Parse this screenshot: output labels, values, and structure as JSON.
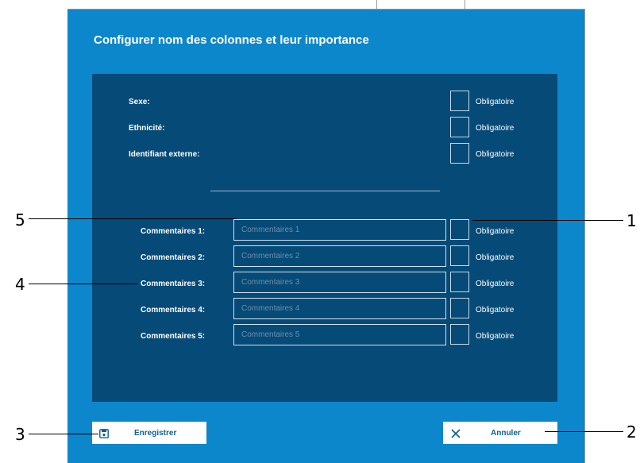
{
  "dialog": {
    "title": "Configurer nom des colonnes et leur importance"
  },
  "fixed_fields": [
    {
      "label": "Sexe:",
      "mandatory_label": "Obligatoire"
    },
    {
      "label": "Ethnicité:",
      "mandatory_label": "Obligatoire"
    },
    {
      "label": "Identifiant externe:",
      "mandatory_label": "Obligatoire"
    }
  ],
  "comment_fields": [
    {
      "label": "Commentaires 1:",
      "placeholder": "Commentaires 1",
      "mandatory_label": "Obligatoire"
    },
    {
      "label": "Commentaires 2:",
      "placeholder": "Commentaires 2",
      "mandatory_label": "Obligatoire"
    },
    {
      "label": "Commentaires 3:",
      "placeholder": "Commentaires 3",
      "mandatory_label": "Obligatoire"
    },
    {
      "label": "Commentaires 4:",
      "placeholder": "Commentaires 4",
      "mandatory_label": "Obligatoire"
    },
    {
      "label": "Commentaires 5:",
      "placeholder": "Commentaires 5",
      "mandatory_label": "Obligatoire"
    }
  ],
  "buttons": {
    "save_label": "Enregistrer",
    "cancel_label": "Annuler"
  },
  "callouts": [
    "1",
    "2",
    "3",
    "4",
    "5"
  ],
  "colors": {
    "dialog_bg": "#0c87cc",
    "panel_bg": "#064a77",
    "button_text": "#0c5f94"
  }
}
